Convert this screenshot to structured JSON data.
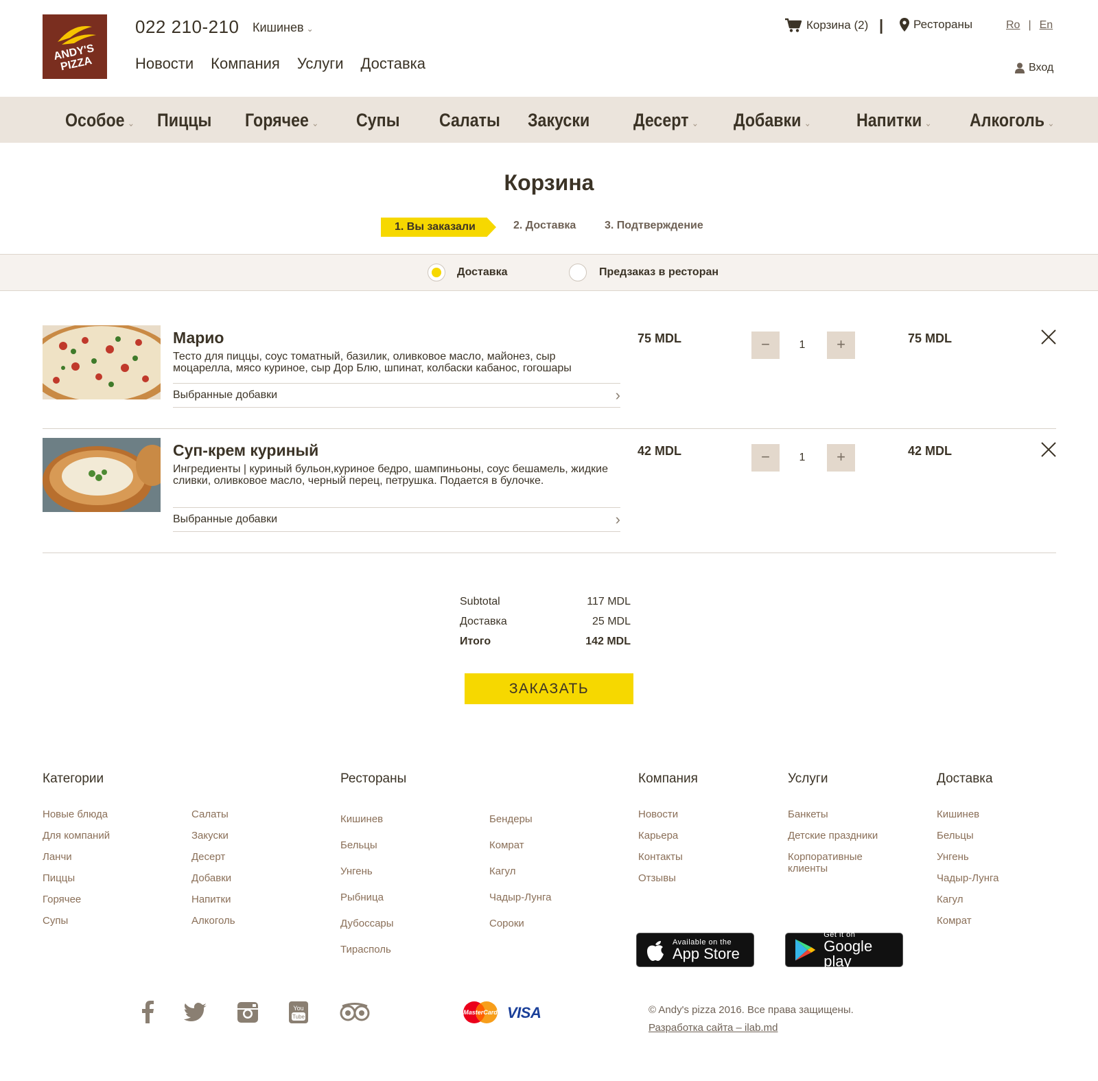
{
  "brand": {
    "logo_line1": "ANDY'S",
    "logo_line2": "PIZZA"
  },
  "header": {
    "phone": "022 210-210",
    "city": "Кишинев",
    "nav": [
      "Новости",
      "Компания",
      "Услуги",
      "Доставка"
    ],
    "cart": "Корзина (2)",
    "separator": "|",
    "restaurants": "Рестораны",
    "lang_ro": "Ro",
    "lang_sep": "|",
    "lang_en": "En",
    "login": "Вход"
  },
  "categories": [
    {
      "label": "Особое",
      "dropdown": true
    },
    {
      "label": "Пиццы",
      "dropdown": false
    },
    {
      "label": "Горячее",
      "dropdown": true
    },
    {
      "label": "Супы",
      "dropdown": false
    },
    {
      "label": "Салаты",
      "dropdown": false
    },
    {
      "label": "Закуски",
      "dropdown": false
    },
    {
      "label": "Десерт",
      "dropdown": true
    },
    {
      "label": "Добавки",
      "dropdown": true
    },
    {
      "label": "Напитки",
      "dropdown": true
    },
    {
      "label": "Алкоголь",
      "dropdown": true
    }
  ],
  "cart_page": {
    "title": "Корзина",
    "steps": [
      "1. Вы заказали",
      "2. Доставка",
      "3. Подтверждение"
    ],
    "active_step": 1,
    "delivery_option": "Доставка",
    "preorder_option": "Предзаказ в ресторан",
    "selected_option": "Доставка"
  },
  "items": [
    {
      "name": "Марио",
      "description": "Тесто для пиццы, соус томатный, базилик, оливковое масло, майонез, сыр моцарелла, мясо куриное, сыр Дор Блю, шпинат, колбаски кабанос, гогошары",
      "addons_label": "Выбранные добавки",
      "unit_price": "75 MDL",
      "quantity": "1",
      "total": "75 MDL",
      "minus": "−",
      "plus": "+"
    },
    {
      "name": "Суп-крем куриный",
      "description": "Ингредиенты | куриный бульон,куриное бедро, шампиньоны, соус бешамель, жидкие сливки, оливковое масло, черный перец, петрушка. Подается в булочке.",
      "addons_label": "Выбранные добавки",
      "unit_price": "42 MDL",
      "quantity": "1",
      "total": "42 MDL",
      "minus": "−",
      "plus": "+"
    }
  ],
  "totals": {
    "subtotal_label": "Subtotal",
    "subtotal_value": "117 MDL",
    "delivery_label": "Доставка",
    "delivery_value": "25 MDL",
    "total_label": "Итого",
    "total_value": "142 MDL",
    "order_button": "ЗАКАЗАТЬ"
  },
  "footer": {
    "categories_title": "Категории",
    "categories_col1": [
      "Новые блюда",
      "Для компаний",
      "Ланчи",
      "Пиццы",
      "Горячее",
      "Супы"
    ],
    "categories_col2": [
      "Салаты",
      "Закуски",
      "Десерт",
      "Добавки",
      "Напитки",
      "Алкоголь"
    ],
    "restaurants_title": "Рестораны",
    "restaurants_col1": [
      "Кишинев",
      "Бельцы",
      "Унгень",
      "Рыбница",
      "Дубоссары",
      "Тирасполь"
    ],
    "restaurants_col2": [
      "Бендеры",
      "Комрат",
      "Кагул",
      "Чадыр-Лунга",
      "Сороки"
    ],
    "company_title": "Компания",
    "company_links": [
      "Новости",
      "Карьера",
      "Контакты",
      "Отзывы"
    ],
    "services_title": "Услуги",
    "services_links": [
      "Банкеты",
      "Детские праздники",
      "Корпоративные клиенты"
    ],
    "delivery_title": "Доставка",
    "delivery_links": [
      "Кишинев",
      "Бельцы",
      "Унгень",
      "Чадыр-Лунга",
      "Кагул",
      "Комрат"
    ],
    "appstore_small": "Available on the",
    "appstore_big": "App Store",
    "googleplay_small": "Get it on",
    "googleplay_big": "Google play",
    "mastercard_text": "MasterCard",
    "visa_text": "VISA",
    "copyright": "© Andy's pizza 2016. Все права защищены.",
    "developer": "Разработка сайта – ilab.md"
  },
  "colors": {
    "accent_yellow": "#f6d800",
    "brand_brown": "#7a2e1f",
    "text_dark": "#3b3326",
    "category_bar": "#ebe4dc",
    "footer_link": "#8a6f58"
  },
  "icons": [
    "cart-icon",
    "location-pin-icon",
    "user-icon",
    "close-icon",
    "chevron-right-icon",
    "chevron-down-icon",
    "apple-icon",
    "google-play-icon",
    "facebook-icon",
    "twitter-icon",
    "instagram-icon",
    "youtube-icon",
    "tripadvisor-icon",
    "mastercard-icon",
    "visa-icon"
  ]
}
